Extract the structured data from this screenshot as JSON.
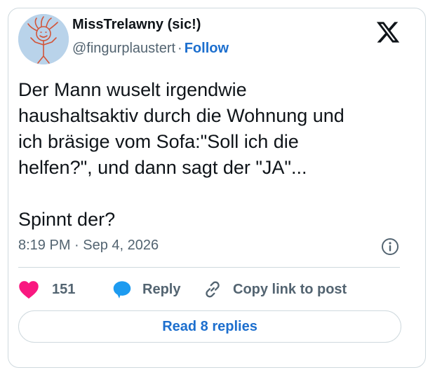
{
  "author": {
    "display_name": "MissTrelawny (sic!)",
    "handle": "@fingurplaustert",
    "separator": "·",
    "follow_label": "Follow"
  },
  "tweet": {
    "lines": [
      "Der Mann wuselt irgendwie",
      "haushaltsaktiv durch die Wohnung und",
      "ich bräsige vom Sofa:\"Soll ich die",
      "helfen?\", und dann sagt der \"JA\"...",
      "Spinnt der?"
    ],
    "timestamp": "8:19 PM · Sep 4, 2026"
  },
  "actions": {
    "like_count": "151",
    "reply_label": "Reply",
    "copy_label": "Copy link to post"
  },
  "read_replies_label": "Read 8 replies",
  "icons": {
    "brand": "x-logo-icon",
    "like": "heart-icon",
    "reply": "speech-bubble-icon",
    "copy": "link-icon",
    "info": "info-icon"
  },
  "colors": {
    "like": "#f91880",
    "reply": "#1d9bf0",
    "link": "#1d6fce",
    "muted": "#536471",
    "border": "#cfd9de"
  }
}
